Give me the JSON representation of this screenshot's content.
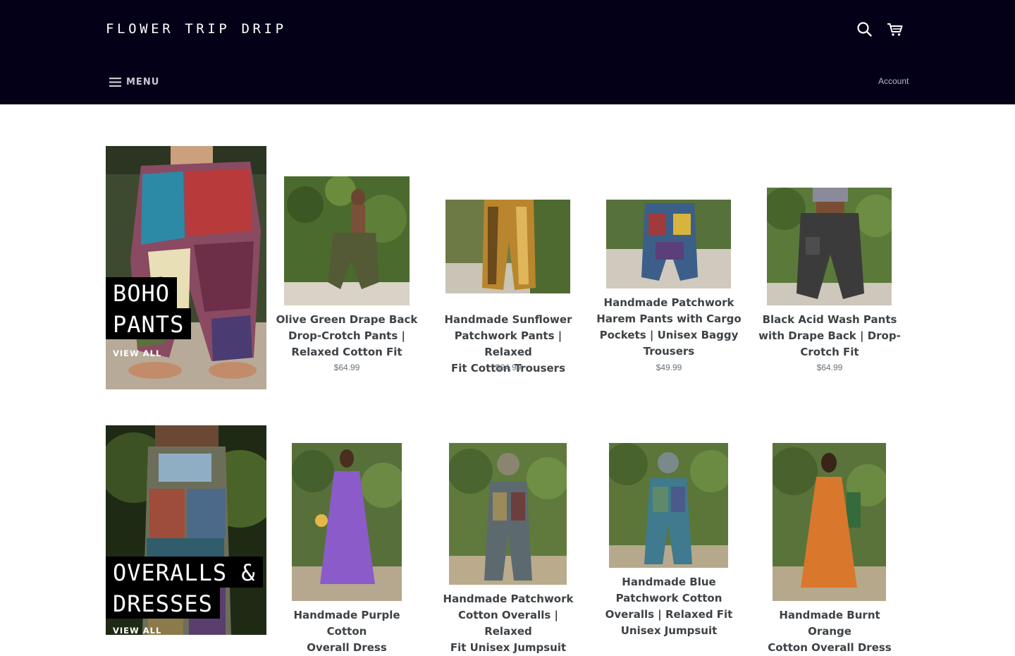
{
  "header": {
    "logo": "FLOWER TRIP DRIP",
    "menu_label": "MENU",
    "account_label": "Account",
    "search_icon": "search-icon",
    "cart_icon": "cart-icon",
    "background_color": "#040018"
  },
  "collections": [
    {
      "title_lines": [
        "BOHO",
        "PANTS"
      ],
      "view_all": "VIEW ALL",
      "products": [
        {
          "name_lines": [
            "Olive Green Drape Back",
            "Drop-Crotch Pants |",
            "Relaxed Cotton Fit"
          ],
          "price": "$64.99"
        },
        {
          "name_lines": [
            "Handmade Sunflower",
            "Patchwork Pants | Relaxed",
            "Fit Cotton Trousers"
          ],
          "price": "$64.99"
        },
        {
          "name_lines": [
            "Handmade Patchwork",
            "Harem Pants with Cargo",
            "Pockets | Unisex Baggy",
            "Trousers"
          ],
          "price": "$49.99"
        },
        {
          "name_lines": [
            "Black Acid Wash Pants",
            "with Drape Back | Drop-",
            "Crotch Fit"
          ],
          "price": "$64.99"
        }
      ]
    },
    {
      "title_lines": [
        "OVERALLS &",
        "DRESSES"
      ],
      "view_all": "VIEW ALL",
      "products": [
        {
          "name_lines": [
            "Handmade Purple Cotton",
            "Overall Dress"
          ]
        },
        {
          "name_lines": [
            "Handmade Patchwork",
            "Cotton Overalls | Relaxed",
            "Fit Unisex Jumpsuit"
          ]
        },
        {
          "name_lines": [
            "Handmade Blue",
            "Patchwork Cotton",
            "Overalls | Relaxed Fit",
            "Unisex Jumpsuit"
          ]
        },
        {
          "name_lines": [
            "Handmade Burnt Orange",
            "Cotton Overall Dress"
          ]
        }
      ]
    }
  ]
}
